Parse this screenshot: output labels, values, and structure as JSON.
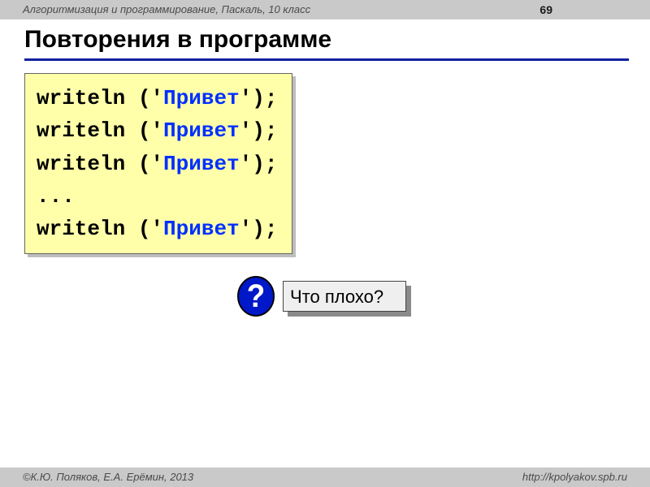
{
  "header": {
    "course": "Алгоритмизация и программирование, Паскаль, 10 класс",
    "page_number": "69"
  },
  "title": "Повторения в программе",
  "code": {
    "lines": [
      {
        "fn": "writeln",
        "open": " ('",
        "str": "Привет",
        "close": "');"
      },
      {
        "fn": "writeln",
        "open": " ('",
        "str": "Привет",
        "close": "');"
      },
      {
        "fn": "writeln",
        "open": " ('",
        "str": "Привет",
        "close": "');"
      },
      {
        "ellipsis": "..."
      },
      {
        "fn": "writeln",
        "open": " ('",
        "str": "Привет",
        "close": "');"
      }
    ]
  },
  "callout": {
    "symbol": "?",
    "text": "Что плохо?"
  },
  "footer": {
    "copyright": "©К.Ю. Поляков, Е.А. Ерёмин, 2013",
    "site": "http://kpolyakov.spb.ru"
  }
}
